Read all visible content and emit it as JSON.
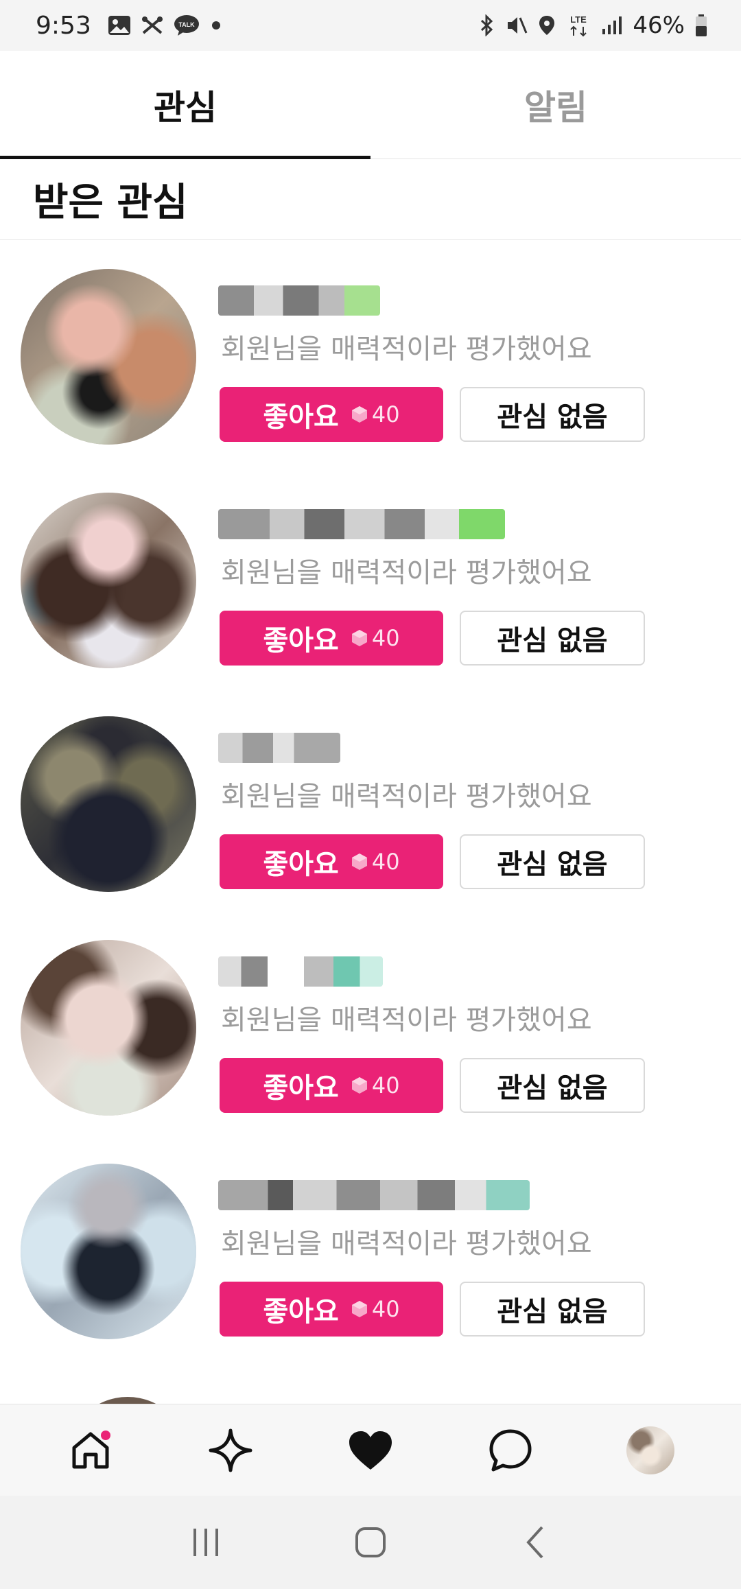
{
  "status_bar": {
    "time": "9:53",
    "network": "LTE",
    "battery": "46%",
    "left_icons": [
      "gallery-icon",
      "scissors-icon",
      "kakaotalk-icon",
      "dot-icon"
    ],
    "right_icons": [
      "bluetooth-icon",
      "mute-icon",
      "location-icon",
      "lte-icon",
      "signal-icon",
      "battery-icon"
    ]
  },
  "tabs": [
    {
      "label": "관심",
      "active": true
    },
    {
      "label": "알림",
      "active": false
    }
  ],
  "section": {
    "title": "받은 관심"
  },
  "items": [
    {
      "description": "회원님을 매력적이라 평가했어요",
      "like_label": "좋아요",
      "cost": "40",
      "nope_label": "관심 없음"
    },
    {
      "description": "회원님을 매력적이라 평가했어요",
      "like_label": "좋아요",
      "cost": "40",
      "nope_label": "관심 없음"
    },
    {
      "description": "회원님을 매력적이라 평가했어요",
      "like_label": "좋아요",
      "cost": "40",
      "nope_label": "관심 없음"
    },
    {
      "description": "회원님을 매력적이라 평가했어요",
      "like_label": "좋아요",
      "cost": "40",
      "nope_label": "관심 없음"
    },
    {
      "description": "회원님을 매력적이라 평가했어요",
      "like_label": "좋아요",
      "cost": "40",
      "nope_label": "관심 없음"
    }
  ],
  "bottom_nav": [
    {
      "icon": "home-icon",
      "badge": true
    },
    {
      "icon": "sparkle-star-icon",
      "badge": false
    },
    {
      "icon": "heart-icon",
      "badge": false
    },
    {
      "icon": "chat-bubble-icon",
      "badge": false
    },
    {
      "icon": "profile-avatar",
      "badge": false
    }
  ],
  "colors": {
    "accent": "#ea2276",
    "muted_text": "#9b9b9b",
    "nav_background": "#f7f7f7"
  }
}
